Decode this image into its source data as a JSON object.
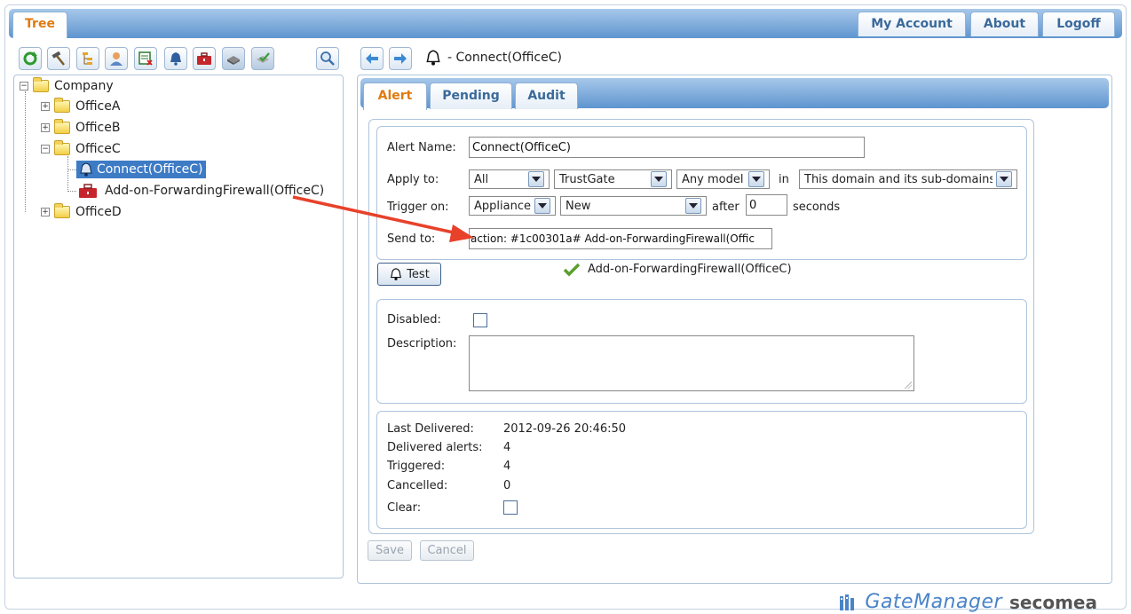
{
  "top_tabs": {
    "tree": "Tree",
    "my_account": "My Account",
    "about": "About",
    "logoff": "Logoff"
  },
  "icons": {
    "refresh": "refresh-icon",
    "tools": "hammer-icon",
    "hierarchy": "hierarchy-icon",
    "user": "user-icon",
    "certificate": "certificate-icon",
    "bell": "bell-icon",
    "toolbox": "toolbox-icon",
    "appliance": "appliance-icon",
    "check": "check-icon",
    "search": "search-icon"
  },
  "tree": {
    "root": "Company",
    "offices": [
      "OfficeA",
      "OfficeB",
      "OfficeC",
      "OfficeD"
    ],
    "selected_alert": "Connect(OfficeC)",
    "action_item": "Add-on-ForwardingFirewall(OfficeC)"
  },
  "header": {
    "crumb": "- Connect(OfficeC)"
  },
  "sub_tabs": {
    "alert": "Alert",
    "pending": "Pending",
    "audit": "Audit"
  },
  "form": {
    "alert_name_label": "Alert Name:",
    "alert_name_value": "Connect(OfficeC)",
    "apply_to_label": "Apply to:",
    "apply_to_scope": "All",
    "apply_to_type": "TrustGate",
    "apply_to_model": "Any model",
    "in_label": "in",
    "apply_to_domain": "This domain and its sub-domains",
    "trigger_label": "Trigger on:",
    "trigger_object": "Appliance",
    "trigger_event": "New",
    "after_label": "after",
    "after_value": "0",
    "seconds_label": "seconds",
    "send_to_label": "Send to:",
    "send_to_value": "action: #1c00301a# Add-on-ForwardingFirewall(Offic",
    "test_button": "Test",
    "test_result": "Add-on-ForwardingFirewall(OfficeC)",
    "disabled_label": "Disabled:",
    "description_label": "Description:"
  },
  "stats": {
    "last_delivered_label": "Last Delivered:",
    "last_delivered_value": "2012-09-26 20:46:50",
    "delivered_label": "Delivered alerts:",
    "delivered_value": "4",
    "triggered_label": "Triggered:",
    "triggered_value": "4",
    "cancelled_label": "Cancelled:",
    "cancelled_value": "0",
    "clear_label": "Clear:"
  },
  "buttons": {
    "save": "Save",
    "cancel": "Cancel"
  },
  "brand": {
    "product": "GateManager",
    "company": "secomea"
  },
  "colors": {
    "accent": "#e07a10",
    "selection": "#3d7bc5",
    "arrow": "#e8412a",
    "check": "#5aa02c"
  }
}
